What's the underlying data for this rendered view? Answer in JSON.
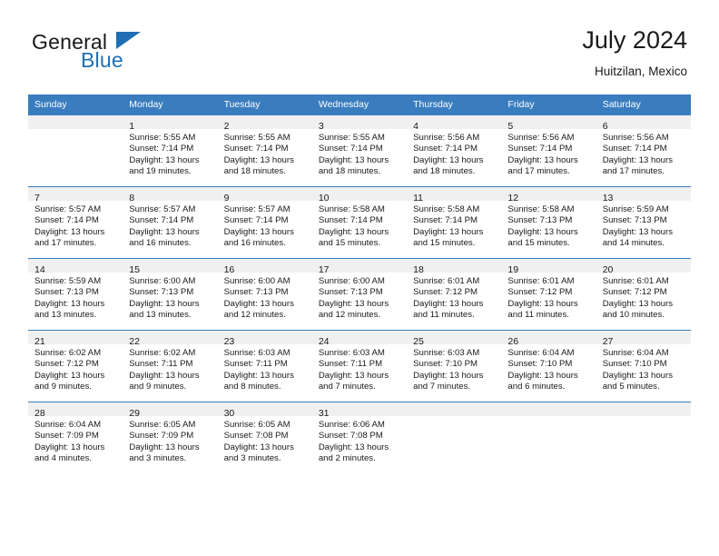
{
  "brand": {
    "name_top": "General",
    "name_bottom": "Blue",
    "accent_color": "#1f6fb4",
    "triangle_icon": "triangle-right-icon"
  },
  "header": {
    "title": "July 2024",
    "subtitle": "Huitzilan, Mexico",
    "header_bg_color": "#3a7dbf",
    "daynum_bg_color": "#f0f0f0"
  },
  "weekdays": [
    "Sunday",
    "Monday",
    "Tuesday",
    "Wednesday",
    "Thursday",
    "Friday",
    "Saturday"
  ],
  "weeks": [
    [
      {
        "day": "",
        "sunrise": "",
        "sunset": "",
        "daylight1": "",
        "daylight2": "",
        "blank": true
      },
      {
        "day": "1",
        "sunrise": "Sunrise: 5:55 AM",
        "sunset": "Sunset: 7:14 PM",
        "daylight1": "Daylight: 13 hours",
        "daylight2": "and 19 minutes."
      },
      {
        "day": "2",
        "sunrise": "Sunrise: 5:55 AM",
        "sunset": "Sunset: 7:14 PM",
        "daylight1": "Daylight: 13 hours",
        "daylight2": "and 18 minutes."
      },
      {
        "day": "3",
        "sunrise": "Sunrise: 5:55 AM",
        "sunset": "Sunset: 7:14 PM",
        "daylight1": "Daylight: 13 hours",
        "daylight2": "and 18 minutes."
      },
      {
        "day": "4",
        "sunrise": "Sunrise: 5:56 AM",
        "sunset": "Sunset: 7:14 PM",
        "daylight1": "Daylight: 13 hours",
        "daylight2": "and 18 minutes."
      },
      {
        "day": "5",
        "sunrise": "Sunrise: 5:56 AM",
        "sunset": "Sunset: 7:14 PM",
        "daylight1": "Daylight: 13 hours",
        "daylight2": "and 17 minutes."
      },
      {
        "day": "6",
        "sunrise": "Sunrise: 5:56 AM",
        "sunset": "Sunset: 7:14 PM",
        "daylight1": "Daylight: 13 hours",
        "daylight2": "and 17 minutes."
      }
    ],
    [
      {
        "day": "7",
        "sunrise": "Sunrise: 5:57 AM",
        "sunset": "Sunset: 7:14 PM",
        "daylight1": "Daylight: 13 hours",
        "daylight2": "and 17 minutes."
      },
      {
        "day": "8",
        "sunrise": "Sunrise: 5:57 AM",
        "sunset": "Sunset: 7:14 PM",
        "daylight1": "Daylight: 13 hours",
        "daylight2": "and 16 minutes."
      },
      {
        "day": "9",
        "sunrise": "Sunrise: 5:57 AM",
        "sunset": "Sunset: 7:14 PM",
        "daylight1": "Daylight: 13 hours",
        "daylight2": "and 16 minutes."
      },
      {
        "day": "10",
        "sunrise": "Sunrise: 5:58 AM",
        "sunset": "Sunset: 7:14 PM",
        "daylight1": "Daylight: 13 hours",
        "daylight2": "and 15 minutes."
      },
      {
        "day": "11",
        "sunrise": "Sunrise: 5:58 AM",
        "sunset": "Sunset: 7:14 PM",
        "daylight1": "Daylight: 13 hours",
        "daylight2": "and 15 minutes."
      },
      {
        "day": "12",
        "sunrise": "Sunrise: 5:58 AM",
        "sunset": "Sunset: 7:13 PM",
        "daylight1": "Daylight: 13 hours",
        "daylight2": "and 15 minutes."
      },
      {
        "day": "13",
        "sunrise": "Sunrise: 5:59 AM",
        "sunset": "Sunset: 7:13 PM",
        "daylight1": "Daylight: 13 hours",
        "daylight2": "and 14 minutes."
      }
    ],
    [
      {
        "day": "14",
        "sunrise": "Sunrise: 5:59 AM",
        "sunset": "Sunset: 7:13 PM",
        "daylight1": "Daylight: 13 hours",
        "daylight2": "and 13 minutes."
      },
      {
        "day": "15",
        "sunrise": "Sunrise: 6:00 AM",
        "sunset": "Sunset: 7:13 PM",
        "daylight1": "Daylight: 13 hours",
        "daylight2": "and 13 minutes."
      },
      {
        "day": "16",
        "sunrise": "Sunrise: 6:00 AM",
        "sunset": "Sunset: 7:13 PM",
        "daylight1": "Daylight: 13 hours",
        "daylight2": "and 12 minutes."
      },
      {
        "day": "17",
        "sunrise": "Sunrise: 6:00 AM",
        "sunset": "Sunset: 7:13 PM",
        "daylight1": "Daylight: 13 hours",
        "daylight2": "and 12 minutes."
      },
      {
        "day": "18",
        "sunrise": "Sunrise: 6:01 AM",
        "sunset": "Sunset: 7:12 PM",
        "daylight1": "Daylight: 13 hours",
        "daylight2": "and 11 minutes."
      },
      {
        "day": "19",
        "sunrise": "Sunrise: 6:01 AM",
        "sunset": "Sunset: 7:12 PM",
        "daylight1": "Daylight: 13 hours",
        "daylight2": "and 11 minutes."
      },
      {
        "day": "20",
        "sunrise": "Sunrise: 6:01 AM",
        "sunset": "Sunset: 7:12 PM",
        "daylight1": "Daylight: 13 hours",
        "daylight2": "and 10 minutes."
      }
    ],
    [
      {
        "day": "21",
        "sunrise": "Sunrise: 6:02 AM",
        "sunset": "Sunset: 7:12 PM",
        "daylight1": "Daylight: 13 hours",
        "daylight2": "and 9 minutes."
      },
      {
        "day": "22",
        "sunrise": "Sunrise: 6:02 AM",
        "sunset": "Sunset: 7:11 PM",
        "daylight1": "Daylight: 13 hours",
        "daylight2": "and 9 minutes."
      },
      {
        "day": "23",
        "sunrise": "Sunrise: 6:03 AM",
        "sunset": "Sunset: 7:11 PM",
        "daylight1": "Daylight: 13 hours",
        "daylight2": "and 8 minutes."
      },
      {
        "day": "24",
        "sunrise": "Sunrise: 6:03 AM",
        "sunset": "Sunset: 7:11 PM",
        "daylight1": "Daylight: 13 hours",
        "daylight2": "and 7 minutes."
      },
      {
        "day": "25",
        "sunrise": "Sunrise: 6:03 AM",
        "sunset": "Sunset: 7:10 PM",
        "daylight1": "Daylight: 13 hours",
        "daylight2": "and 7 minutes."
      },
      {
        "day": "26",
        "sunrise": "Sunrise: 6:04 AM",
        "sunset": "Sunset: 7:10 PM",
        "daylight1": "Daylight: 13 hours",
        "daylight2": "and 6 minutes."
      },
      {
        "day": "27",
        "sunrise": "Sunrise: 6:04 AM",
        "sunset": "Sunset: 7:10 PM",
        "daylight1": "Daylight: 13 hours",
        "daylight2": "and 5 minutes."
      }
    ],
    [
      {
        "day": "28",
        "sunrise": "Sunrise: 6:04 AM",
        "sunset": "Sunset: 7:09 PM",
        "daylight1": "Daylight: 13 hours",
        "daylight2": "and 4 minutes."
      },
      {
        "day": "29",
        "sunrise": "Sunrise: 6:05 AM",
        "sunset": "Sunset: 7:09 PM",
        "daylight1": "Daylight: 13 hours",
        "daylight2": "and 3 minutes."
      },
      {
        "day": "30",
        "sunrise": "Sunrise: 6:05 AM",
        "sunset": "Sunset: 7:08 PM",
        "daylight1": "Daylight: 13 hours",
        "daylight2": "and 3 minutes."
      },
      {
        "day": "31",
        "sunrise": "Sunrise: 6:06 AM",
        "sunset": "Sunset: 7:08 PM",
        "daylight1": "Daylight: 13 hours",
        "daylight2": "and 2 minutes."
      },
      {
        "day": "",
        "sunrise": "",
        "sunset": "",
        "daylight1": "",
        "daylight2": "",
        "blank": true
      },
      {
        "day": "",
        "sunrise": "",
        "sunset": "",
        "daylight1": "",
        "daylight2": "",
        "blank": true
      },
      {
        "day": "",
        "sunrise": "",
        "sunset": "",
        "daylight1": "",
        "daylight2": "",
        "blank": true
      }
    ]
  ]
}
